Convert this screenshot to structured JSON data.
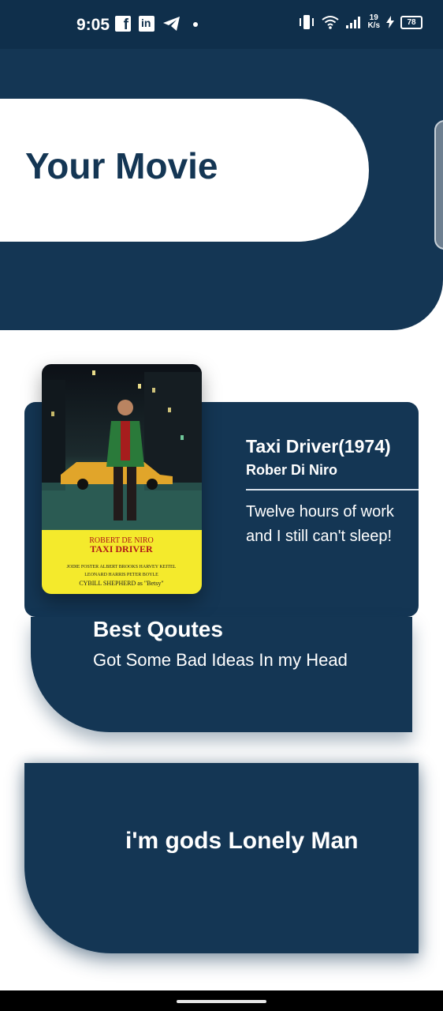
{
  "status_bar": {
    "time": "9:05",
    "icons": [
      "facebook-icon",
      "linkedin-icon",
      "telegram-icon",
      "dot-icon",
      "vibrate-icon",
      "wifi-icon",
      "signal-icon",
      "charging-icon"
    ],
    "net_speed_value": "19",
    "net_speed_unit": "K/s",
    "battery": "78"
  },
  "header": {
    "title": "Your Movie"
  },
  "movie": {
    "title": "Taxi Driver(1974)",
    "actor": "Rober Di Niro",
    "quote": "Twelve hours of work and I still can't sleep!",
    "poster": {
      "actor_text": "ROBERT DE NIRO",
      "title_text": "TAXI DRIVER",
      "credits_1": "JODIE FOSTER  ALBERT BROOKS  HARVEY KEITEL",
      "credits_2": "LEONARD HARRIS  PETER BOYLE",
      "credits_3": "CYBILL SHEPHERD as \"Betsy\""
    }
  },
  "best_quotes": {
    "title": "Best Qoutes",
    "text": "Got Some Bad Ideas In my Head"
  },
  "lonely_card": {
    "text": "i'm gods Lonely Man"
  },
  "colors": {
    "primary": "#143654",
    "status_bar": "#0f2f4b",
    "background": "#ffffff",
    "poster_yellow": "#f4ea2c"
  }
}
